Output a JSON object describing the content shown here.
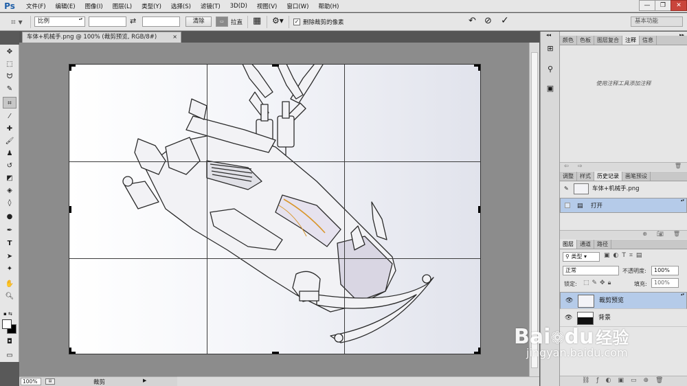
{
  "app": {
    "logo": "Ps"
  },
  "menu": [
    "文件(F)",
    "编辑(E)",
    "图像(I)",
    "图层(L)",
    "类型(Y)",
    "选择(S)",
    "滤镜(T)",
    "3D(D)",
    "视图(V)",
    "窗口(W)",
    "帮助(H)"
  ],
  "window_controls": {
    "minimize": "—",
    "restore": "❐",
    "close": "✕"
  },
  "options": {
    "ratio_select": "比例",
    "width_value": "",
    "height_value": "",
    "swap_icon": "⇄",
    "clear_label": "清除",
    "straighten_label": "拉直",
    "delete_pixels_checked": true,
    "delete_pixels_label": "删除裁剪的像素",
    "workspace": "基本功能",
    "checkmark": "✓"
  },
  "document": {
    "tab_title": "车体+机械手.png @ 100% (裁剪预览, RGB/8#)",
    "close": "×"
  },
  "status": {
    "zoom": "100%",
    "tool_name": "裁剪",
    "arrow": "▶"
  },
  "panels": {
    "top_tabs": [
      "颜色",
      "色板",
      "图层复合",
      "注释",
      "信息"
    ],
    "top_active": "注释",
    "notes_hint": "使用注释工具添加注释",
    "mid_tabs": [
      "调整",
      "样式",
      "历史记录",
      "画笔预设"
    ],
    "mid_active": "历史记录",
    "history": [
      {
        "label": "车体+机械手.png",
        "type": "snapshot"
      },
      {
        "label": "打开",
        "type": "step",
        "selected": true
      }
    ],
    "layer_tabs": [
      "图层",
      "通道",
      "路径"
    ],
    "layer_active": "图层",
    "filter_kind": "类型",
    "blend_mode": "正常",
    "opacity_label": "不透明度:",
    "opacity_value": "100%",
    "lock_label": "锁定:",
    "fill_label": "填充:",
    "fill_value": "100%",
    "layers": [
      {
        "name": "裁剪预览",
        "selected": true
      },
      {
        "name": "背景",
        "selected": false
      }
    ]
  },
  "watermark": {
    "brand": "Bai",
    "brand2": "du",
    "cn": "经验",
    "url": "jingyan.baidu.com"
  }
}
